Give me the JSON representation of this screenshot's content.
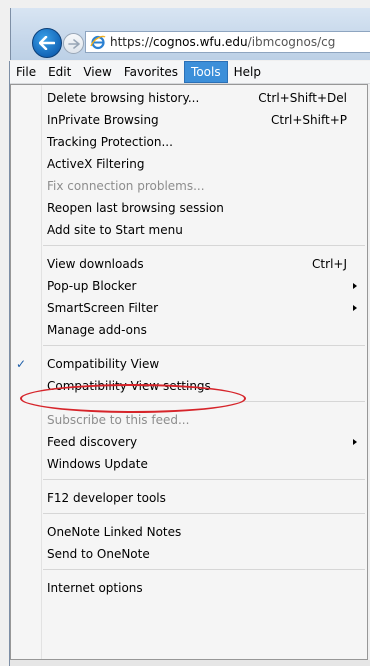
{
  "browser": {
    "url_prefix": "https://",
    "url_host": "cognos.wfu.edu",
    "url_path": "/ibmcognos/cg"
  },
  "menubar": {
    "items": [
      {
        "label": "File"
      },
      {
        "label": "Edit"
      },
      {
        "label": "View"
      },
      {
        "label": "Favorites"
      },
      {
        "label": "Tools"
      },
      {
        "label": "Help"
      }
    ],
    "active": "Tools"
  },
  "tools_menu": {
    "items": [
      {
        "label": "Delete browsing history...",
        "shortcut": "Ctrl+Shift+Del"
      },
      {
        "label": "InPrivate Browsing",
        "shortcut": "Ctrl+Shift+P"
      },
      {
        "label": "Tracking Protection...",
        "shortcut": ""
      },
      {
        "label": "ActiveX Filtering",
        "shortcut": ""
      },
      {
        "label": "Fix connection problems...",
        "shortcut": "",
        "disabled": true
      },
      {
        "label": "Reopen last browsing session",
        "shortcut": ""
      },
      {
        "label": "Add site to Start menu",
        "shortcut": ""
      },
      {
        "label": "View downloads",
        "shortcut": "Ctrl+J"
      },
      {
        "label": "Pop-up Blocker",
        "shortcut": "",
        "submenu": true
      },
      {
        "label": "SmartScreen Filter",
        "shortcut": "",
        "submenu": true
      },
      {
        "label": "Manage add-ons",
        "shortcut": ""
      },
      {
        "label": "Compatibility View",
        "shortcut": "",
        "checked": true
      },
      {
        "label": "Compatibility View settings",
        "shortcut": "",
        "highlighted": true
      },
      {
        "label": "Subscribe to this feed...",
        "shortcut": "",
        "disabled": true
      },
      {
        "label": "Feed discovery",
        "shortcut": "",
        "submenu": true
      },
      {
        "label": "Windows Update",
        "shortcut": ""
      },
      {
        "label": "F12 developer tools",
        "shortcut": ""
      },
      {
        "label": "OneNote Linked Notes",
        "shortcut": ""
      },
      {
        "label": "Send to OneNote",
        "shortcut": ""
      },
      {
        "label": "Internet options",
        "shortcut": ""
      }
    ],
    "check_mark": "✓"
  },
  "icons": {
    "back": "back-arrow-icon",
    "forward": "forward-arrow-icon",
    "site": "internet-explorer-icon",
    "submenu": "submenu-arrow-icon",
    "check": "check-icon"
  },
  "colors": {
    "active_menu": "#3c8fd9",
    "highlight_oval": "#d6242a"
  }
}
